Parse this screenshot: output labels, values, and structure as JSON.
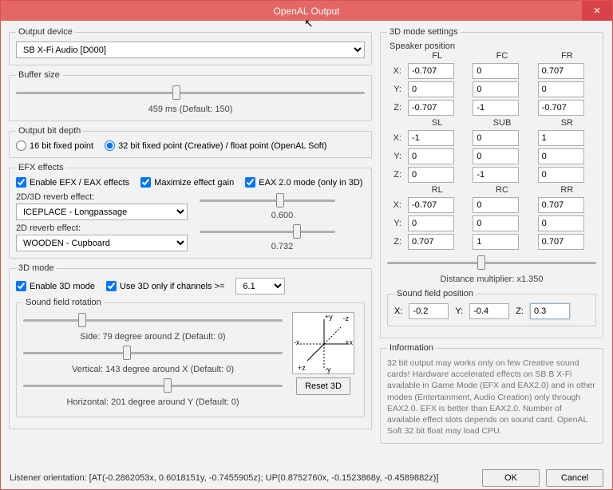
{
  "title": "OpenAL Output",
  "outputDevice": {
    "label": "Output device",
    "value": "SB X-Fi Audio [D000]"
  },
  "bufferSize": {
    "label": "Buffer size",
    "value": 459,
    "caption": "459 ms (Default: 150)"
  },
  "bitDepth": {
    "label": "Output bit depth",
    "opt16": "16 bit fixed point",
    "opt32": "32 bit fixed point (Creative) / float point (OpenAL Soft)"
  },
  "efx": {
    "label": "EFX effects",
    "enable": "Enable EFX / EAX effects",
    "maxgain": "Maximize effect gain",
    "eax2": "EAX 2.0 mode (only in 3D)",
    "rev2d3d_label": "2D/3D reverb effect:",
    "rev2d3d_value": "ICEPLACE - Longpassage",
    "rev2d3d_amt": "0.600",
    "rev2d_label": "2D reverb effect:",
    "rev2d_value": "WOODEN - Cupboard",
    "rev2d_amt": "0.732"
  },
  "mode3d": {
    "label": "3D mode",
    "enable": "Enable 3D mode",
    "useif": "Use 3D only if channels >=",
    "chan": "6.1",
    "rotation_label": "Sound field rotation",
    "side_caption": "Side: 79 degree around Z (Default: 0)",
    "vert_caption": "Vertical: 143 degree around X (Default: 0)",
    "horiz_caption": "Horizontal: 201 degree around Y (Default: 0)",
    "reset": "Reset 3D"
  },
  "axes": {
    "py": "+y",
    "ny": "-y",
    "px": "+x",
    "nx": "-x",
    "pz": "+z",
    "nz": "-z"
  },
  "settings3d": {
    "label": "3D mode settings",
    "speaker_label": "Speaker position",
    "cols1": [
      "FL",
      "FC",
      "FR"
    ],
    "cols2": [
      "SL",
      "SUB",
      "SR"
    ],
    "cols3": [
      "RL",
      "RC",
      "RR"
    ],
    "rows": [
      "X:",
      "Y:",
      "Z:"
    ],
    "grp1": {
      "x": [
        "-0.707",
        "0",
        "0.707"
      ],
      "y": [
        "0",
        "0",
        "0"
      ],
      "z": [
        "-0.707",
        "-1",
        "-0.707"
      ]
    },
    "grp2": {
      "x": [
        "-1",
        "0",
        "1"
      ],
      "y": [
        "0",
        "0",
        "0"
      ],
      "z": [
        "0",
        "-1",
        "0"
      ]
    },
    "grp3": {
      "x": [
        "-0.707",
        "0",
        "0.707"
      ],
      "y": [
        "0",
        "0",
        "0"
      ],
      "z": [
        "0.707",
        "1",
        "0.707"
      ]
    },
    "dist_caption": "Distance multiplier: x1.350",
    "fieldpos_label": "Sound field position",
    "fx": "-0.2",
    "fy": "-0.4",
    "fz": "0.3"
  },
  "info": {
    "label": "Information",
    "text": "32 bit output may works only on few Creative sound cards! Hardware accelerated effects on SB B X-Fi available in Game Mode (EFX and EAX2.0) and in other modes (Entertainment, Audio Creation) only through EAX2.0. EFX is better than EAX2.0. Number of available effect slots depends on sound card. OpenAL Soft 32 bit float may load CPU."
  },
  "footer": {
    "listener": "Listener orientation: [AT(-0.2862053x, 0.6018151y, -0.7455905z); UP(0.8752760x, -0.1523868y, -0.4589882z)]",
    "ok": "OK",
    "cancel": "Cancel"
  }
}
